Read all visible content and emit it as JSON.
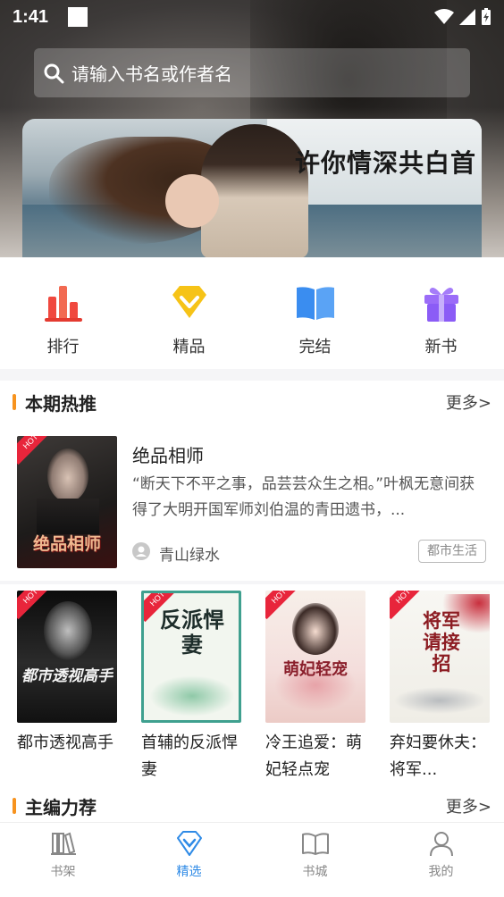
{
  "status_bar": {
    "time": "1:41"
  },
  "search": {
    "placeholder": "请输入书名或作者名"
  },
  "banner": {
    "title": "许你情深共白首"
  },
  "categories": [
    {
      "label": "排行",
      "icon": "bar-chart-icon",
      "color": "#f0483e"
    },
    {
      "label": "精品",
      "icon": "diamond-icon",
      "color": "#f6c317"
    },
    {
      "label": "完结",
      "icon": "open-book-icon",
      "color": "#3a8df0"
    },
    {
      "label": "新书",
      "icon": "gift-icon",
      "color": "#8b5cf6"
    }
  ],
  "hot_section": {
    "title": "本期热推",
    "more": "更多>"
  },
  "featured_book": {
    "badge": "HOT",
    "title": "绝品相师",
    "description": "“断天下不平之事，品芸芸众生之相。”叶枫无意间获得了大明开国军师刘伯温的青田遗书，...",
    "author": "青山绿水",
    "tag": "都市生活",
    "cover_text": "绝品相师"
  },
  "books": [
    {
      "badge": "HOT",
      "title": "都市透视高手",
      "cover_text": "都市透视高手"
    },
    {
      "badge": "HOT",
      "title": "首辅的反派悍妻",
      "cover_text": "反派悍妻"
    },
    {
      "badge": "HOT",
      "title": "冷王追爱：萌妃轻点宠",
      "cover_text": "萌妃轻宠"
    },
    {
      "badge": "HOT",
      "title": "弃妇要休夫：将军...",
      "cover_text": "将军请接招"
    }
  ],
  "editor_section": {
    "title": "主编力荐",
    "more": "更多>"
  },
  "bottom_nav": [
    {
      "label": "书架",
      "icon": "bookshelf-icon"
    },
    {
      "label": "精选",
      "icon": "diamond-outline-icon",
      "active": true
    },
    {
      "label": "书城",
      "icon": "book-icon"
    },
    {
      "label": "我的",
      "icon": "person-icon"
    }
  ],
  "colors": {
    "accent": "#2e8ae6",
    "section_bar": "#f7931e",
    "hot_badge": "#e8253b"
  }
}
